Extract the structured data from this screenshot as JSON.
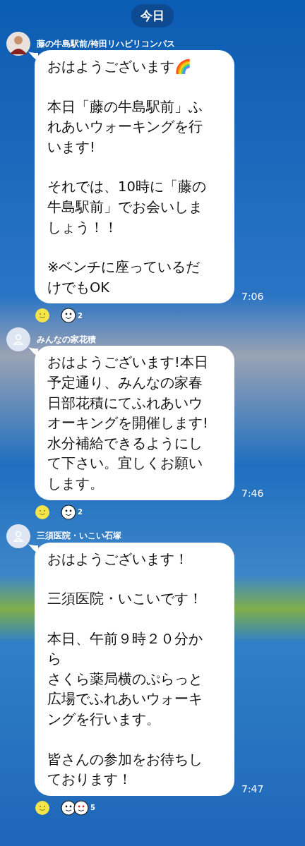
{
  "date_label": "今日",
  "messages": [
    {
      "sender": "藤の牛島駅前/袴田リハビリコンパス",
      "avatar": {
        "kind": "photo"
      },
      "paragraphs": [
        [
          "おはようございます🌈"
        ],
        [
          "本日「藤の牛島駅前」ふ",
          "れあいウォーキングを行",
          "います!"
        ],
        [
          "それでは、10時に「藤の",
          "牛島駅前」でお会いしま",
          "しょう！！"
        ],
        [
          "※ベンチに座っているだ",
          "けでもOK"
        ]
      ],
      "time": "7:06",
      "reaction_count": "2",
      "stickers": [
        {
          "kind": "plain"
        }
      ]
    },
    {
      "sender": "みんなの家花積",
      "avatar": {
        "kind": "default"
      },
      "paragraphs": [
        [
          "おはようございます!本日",
          "予定通り、みんなの家春",
          "日部花積にてふれあいウ",
          "オーキングを開催します!",
          "水分補給できるようにし",
          "て下さい。宜しくお願い",
          "します。"
        ]
      ],
      "time": "7:46",
      "reaction_count": "2",
      "stickers": [
        {
          "kind": "plain"
        }
      ]
    },
    {
      "sender": "三須医院・いこい石塚",
      "avatar": {
        "kind": "default"
      },
      "paragraphs": [
        [
          "おはようございます！"
        ],
        [
          "三須医院・いこいです！"
        ],
        [
          "本日、午前９時２０分か",
          "ら",
          "さくら薬局横のぷらっと",
          "広場でふれあいウォーキ",
          "ングを行います。"
        ],
        [
          "皆さんの参加をお待ちし",
          "ております！"
        ]
      ],
      "time": "7:47",
      "reaction_count": "5",
      "stickers": [
        {
          "kind": "plain"
        },
        {
          "kind": "heart"
        }
      ]
    }
  ]
}
